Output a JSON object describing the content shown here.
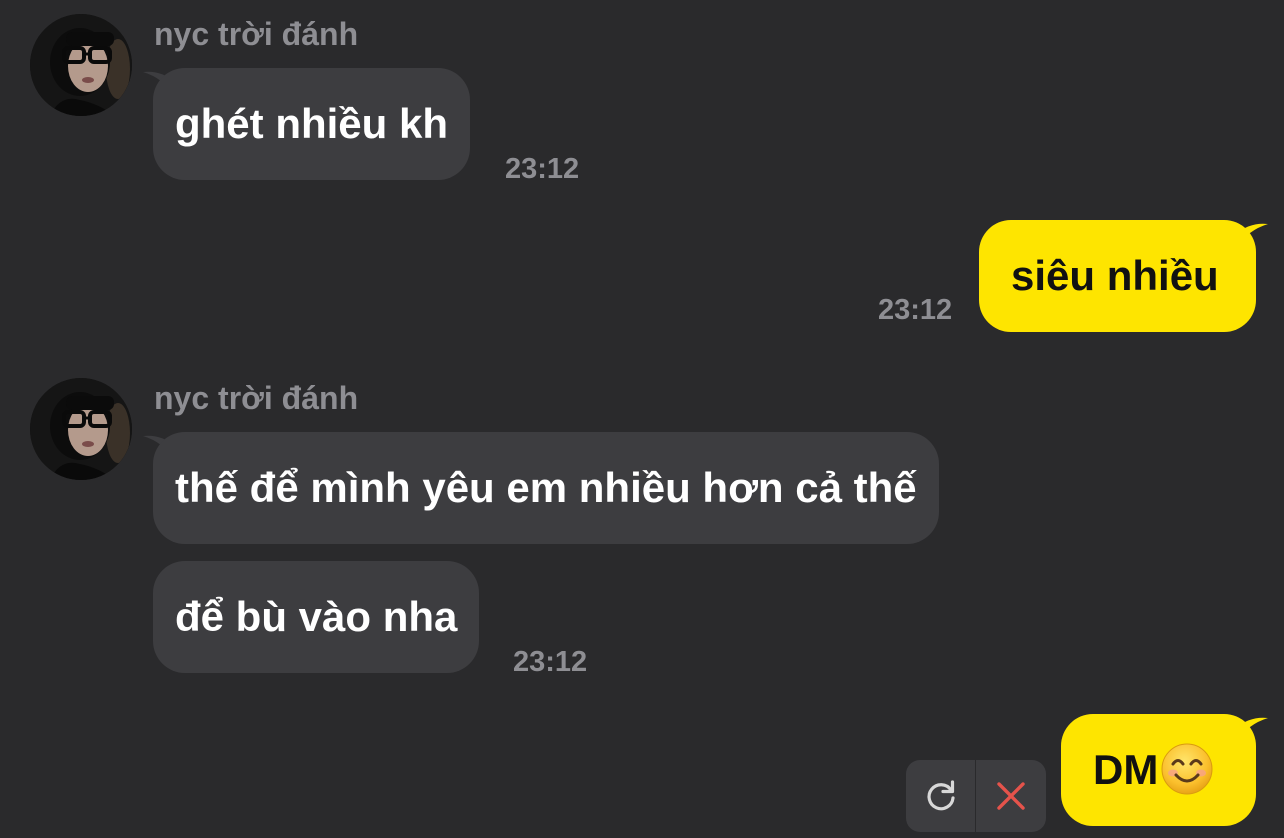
{
  "conversation": {
    "contact_name": "nyc trời đánh",
    "colors": {
      "background": "#2a2a2c",
      "incoming_bubble": "#3d3d40",
      "outgoing_bubble": "#fee500",
      "meta_text": "#8e8e93",
      "delete_icon": "#e5534b"
    },
    "groups": [
      {
        "direction": "incoming",
        "sender": "nyc trời đánh",
        "messages": [
          "ghét nhiều kh"
        ],
        "time": "23:12"
      },
      {
        "direction": "outgoing",
        "messages": [
          "siêu nhiều"
        ],
        "time": "23:12"
      },
      {
        "direction": "incoming",
        "sender": "nyc trời đánh",
        "messages": [
          "thế để mình yêu em nhiều hơn cả thế",
          "để bù vào nha"
        ],
        "time": "23:12"
      },
      {
        "direction": "outgoing",
        "messages": [
          "DM"
        ],
        "emoji": "smiling-face-emoji",
        "status": "failed",
        "actions": [
          "retry-icon",
          "delete-icon"
        ]
      }
    ]
  }
}
